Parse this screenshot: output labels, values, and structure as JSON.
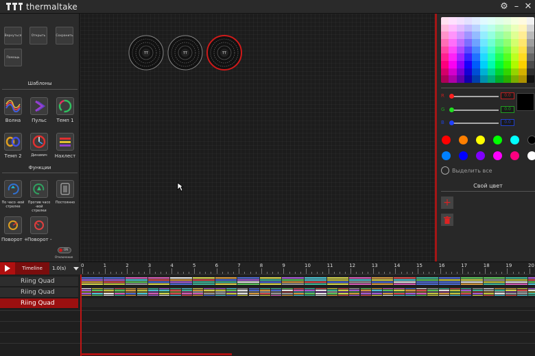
{
  "app": {
    "title": "thermaltake"
  },
  "colors": {
    "accent": "#b01010",
    "panel": "#2b2b2b",
    "canvas": "#1c1c1c"
  },
  "toolbar": {
    "buttons": [
      {
        "label": "Вернуться"
      },
      {
        "label": "Открыть"
      },
      {
        "label": "Сохранить"
      },
      {
        "label": "Помощь"
      }
    ]
  },
  "templates": {
    "title": "Шаблоны",
    "items": [
      {
        "label": "Волна",
        "icon": "wave-icon"
      },
      {
        "label": "Пульс",
        "icon": "pulse-icon"
      },
      {
        "label": "Темп 1",
        "icon": "tempo1-icon"
      },
      {
        "label": "Темп 2",
        "icon": "tempo2-icon"
      },
      {
        "label": "Динамич",
        "icon": "dynamic-icon"
      },
      {
        "label": "Нахлест",
        "icon": "overlap-icon"
      }
    ]
  },
  "functions": {
    "title": "Функции",
    "items": [
      {
        "label": "По часо -вой стрелке",
        "icon": "clockwise-icon"
      },
      {
        "label": "Против часо -вой стрелки",
        "icon": "counterclockwise-icon"
      },
      {
        "label": "Постоянно",
        "icon": "constant-icon"
      },
      {
        "label": "Поворот +",
        "icon": "rotate-plus-icon"
      },
      {
        "label": "Поворот -",
        "icon": "rotate-minus-icon"
      }
    ],
    "toggle_text": "ON",
    "toggle_label": "Отключение"
  },
  "colorpanel": {
    "r": {
      "label": "R",
      "value": "0.0"
    },
    "g": {
      "label": "G",
      "value": "0.0"
    },
    "b": {
      "label": "B",
      "value": "0.0"
    },
    "preset_colors": [
      "#ff0000",
      "#ff7f00",
      "#ffff00",
      "#00ff00",
      "#00ffff",
      "#000000",
      "#0080ff",
      "#0000ff",
      "#8000ff",
      "#ff00ff",
      "#ff0080",
      "#ffffff"
    ],
    "select_all": "Выделить все",
    "custom_title": "Свой цвет",
    "add_icon": "plus-icon",
    "delete_icon": "trash-icon"
  },
  "timeline": {
    "tab": "Timeline",
    "speed": "1.0(s)",
    "ruler": [
      "0",
      "1",
      "2",
      "3",
      "4",
      "5",
      "6",
      "7",
      "8",
      "9",
      "10",
      "11",
      "12",
      "13",
      "14",
      "15",
      "16",
      "17",
      "18",
      "19",
      "20"
    ],
    "tracks": [
      {
        "label": "Riing Quad"
      },
      {
        "label": "Riing Quad"
      },
      {
        "label": "Riing Quad"
      }
    ]
  }
}
